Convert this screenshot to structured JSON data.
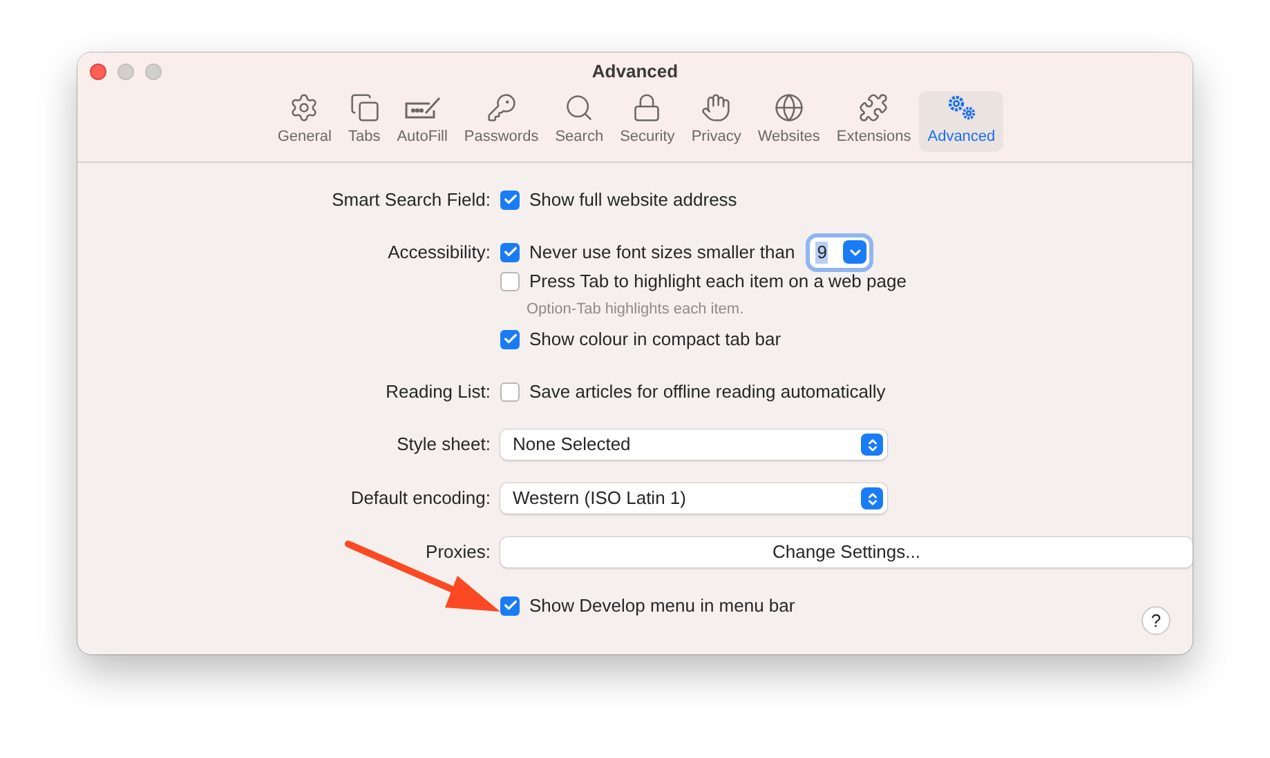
{
  "window": {
    "title": "Advanced"
  },
  "tabs": [
    {
      "label": "General",
      "selected": false
    },
    {
      "label": "Tabs",
      "selected": false
    },
    {
      "label": "AutoFill",
      "selected": false
    },
    {
      "label": "Passwords",
      "selected": false
    },
    {
      "label": "Search",
      "selected": false
    },
    {
      "label": "Security",
      "selected": false
    },
    {
      "label": "Privacy",
      "selected": false
    },
    {
      "label": "Websites",
      "selected": false
    },
    {
      "label": "Extensions",
      "selected": false
    },
    {
      "label": "Advanced",
      "selected": true
    }
  ],
  "sections": [
    {
      "label": "Smart Search Field:",
      "items": [
        {
          "kind": "checkbox",
          "label": "Show full website address",
          "checked": true
        }
      ]
    },
    {
      "label": "Accessibility:",
      "items": [
        {
          "kind": "checkbox",
          "label": "Never use font sizes smaller than",
          "checked": true,
          "size": "9"
        },
        {
          "kind": "checkbox",
          "label": "Press Tab to highlight each item on a web page",
          "checked": false
        },
        {
          "kind": "hint",
          "label": "Option-Tab highlights each item."
        },
        {
          "kind": "checkbox",
          "label": "Show colour in compact tab bar",
          "checked": true
        }
      ]
    },
    {
      "label": "Reading List:",
      "items": [
        {
          "kind": "checkbox",
          "label": "Save articles for offline reading automatically",
          "checked": false
        }
      ]
    },
    {
      "label": "Style sheet:",
      "items": [
        {
          "kind": "select",
          "label": "None Selected"
        }
      ]
    },
    {
      "label": "Default encoding:",
      "items": [
        {
          "kind": "select",
          "label": "Western (ISO Latin 1)"
        }
      ]
    },
    {
      "label": "Proxies:",
      "items": [
        {
          "kind": "button",
          "label": "Change Settings..."
        }
      ]
    },
    {
      "items": [
        {
          "kind": "checkbox",
          "label": "Show Develop menu in menu bar",
          "checked": true
        }
      ]
    }
  ],
  "help_button": "?"
}
